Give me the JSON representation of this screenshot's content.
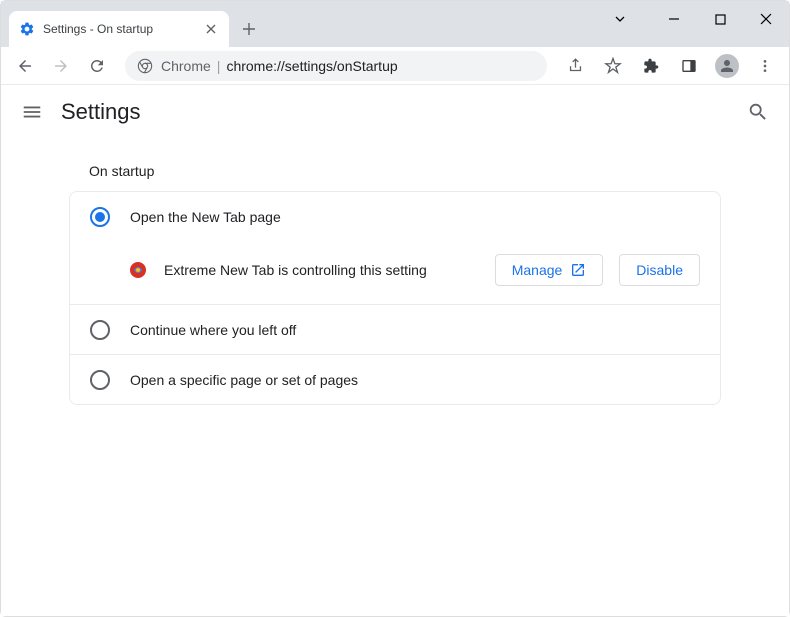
{
  "tab": {
    "title": "Settings - On startup"
  },
  "omnibox": {
    "prefix": "Chrome",
    "url": "chrome://settings/onStartup"
  },
  "header": {
    "title": "Settings"
  },
  "section": {
    "title": "On startup",
    "options": [
      {
        "label": "Open the New Tab page",
        "selected": true
      },
      {
        "label": "Continue where you left off",
        "selected": false
      },
      {
        "label": "Open a specific page or set of pages",
        "selected": false
      }
    ],
    "extension_notice": "Extreme New Tab is controlling this setting",
    "manage_label": "Manage",
    "disable_label": "Disable"
  }
}
